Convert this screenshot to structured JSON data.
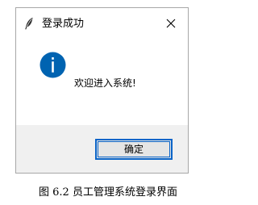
{
  "dialog": {
    "title": "登录成功",
    "app_icon": "feather-icon",
    "close_icon": "close-icon",
    "info_icon": "info-icon",
    "message": "欢迎进入系统!",
    "ok_label": "确定",
    "accent_color": "#0a64c8",
    "info_icon_color": "#0063b1"
  },
  "caption": "图 6.2  员工管理系统登录界面"
}
